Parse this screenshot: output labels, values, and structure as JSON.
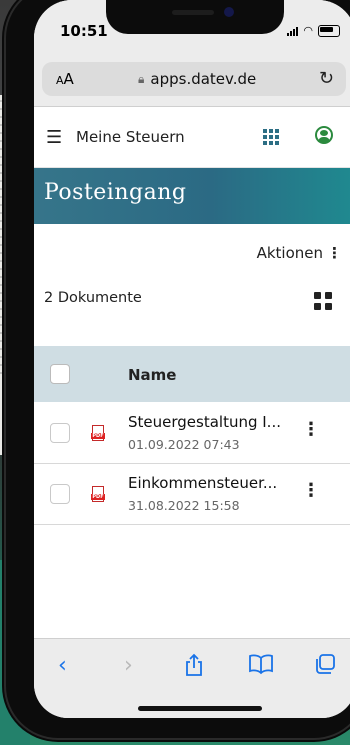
{
  "status_bar": {
    "time": "10:51"
  },
  "browser": {
    "text_size_label": "AA",
    "url": "apps.datev.de",
    "icons": {
      "lock": "lock-icon",
      "reload": "reload-icon"
    }
  },
  "app": {
    "title": "Meine Steuern",
    "icons": {
      "menu": "hamburger-icon",
      "apps": "apps-grid-icon",
      "user": "user-icon"
    }
  },
  "section": {
    "title": "Posteingang",
    "actions_label": "Aktionen",
    "doc_count": "2 Dokumente"
  },
  "table": {
    "column_name": "Name",
    "rows": [
      {
        "title": "Steuergestaltung I...",
        "date": "01.09.2022 07:43"
      },
      {
        "title": "Einkommensteuer...",
        "date": "31.08.2022 15:58"
      }
    ]
  },
  "toolbar": {
    "items": [
      "back-icon",
      "forward-icon",
      "share-icon",
      "bookmarks-icon",
      "tabs-icon"
    ]
  },
  "colors": {
    "banner": "#2b6a84",
    "accent_blue": "#1a73e8",
    "header_row": "#cfdde3",
    "user_green": "#2b8a3e",
    "pdf_red": "#d22222"
  }
}
